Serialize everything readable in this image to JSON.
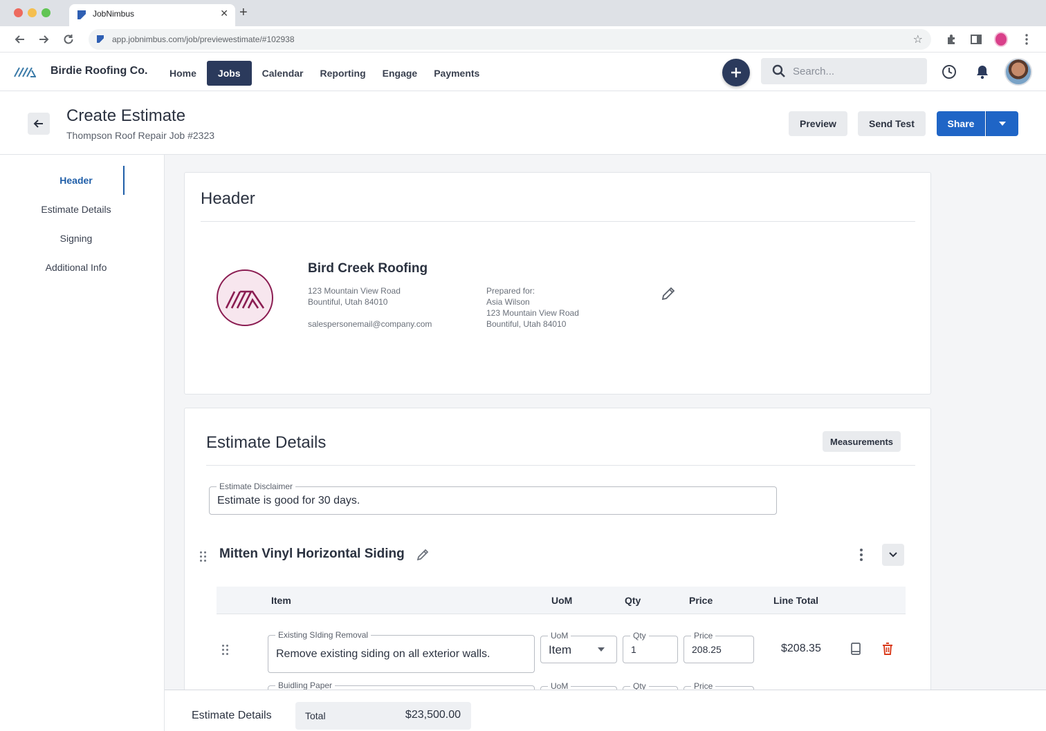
{
  "browser": {
    "tab_title": "JobNimbus",
    "url": "app.jobnimbus.com/job/previewestimate/#102938"
  },
  "app": {
    "brand": "Birdie Roofing Co.",
    "nav": [
      "Home",
      "Jobs",
      "Calendar",
      "Reporting",
      "Engage",
      "Payments"
    ],
    "active_nav": "Jobs",
    "search_placeholder": "Search..."
  },
  "page": {
    "title": "Create Estimate",
    "subtitle": "Thompson Roof Repair Job #2323",
    "preview_label": "Preview",
    "send_test_label": "Send Test",
    "share_label": "Share"
  },
  "sidebar": {
    "items": [
      "Header",
      "Estimate Details",
      "Signing",
      "Additional Info"
    ],
    "active": "Header"
  },
  "header_card": {
    "title": "Header",
    "company_name": "Bird Creek Roofing",
    "company_address_line1": "123 Mountain View Road",
    "company_address_line2": "Bountiful, Utah 84010",
    "company_email": "salespersonemail@company.com",
    "prepared_for_label": "Prepared for:",
    "client_name": "Asia Wilson",
    "client_address_line1": "123 Mountain View Road",
    "client_address_line2": "Bountiful, Utah 84010"
  },
  "estimate_card": {
    "title": "Estimate Details",
    "measurements_label": "Measurements",
    "disclaimer_label": "Estimate Disclaimer",
    "disclaimer_value": "Estimate is good for 30 days.",
    "section_title": "Mitten Vinyl Horizontal Siding",
    "columns": [
      "Item",
      "UoM",
      "Qty",
      "Price",
      "Line Total"
    ],
    "rows": [
      {
        "item_label": "Existing SIding Removal",
        "item_value": "Remove existing siding on all exterior walls.",
        "uom_label": "UoM",
        "uom_value": "Item",
        "qty_label": "Qty",
        "qty_value": "1",
        "price_label": "Price",
        "price_value": "208.25",
        "line_total": "$208.35"
      },
      {
        "item_label": "Buidling Paper",
        "uom_label": "UoM",
        "qty_label": "Qty",
        "price_label": "Price"
      }
    ]
  },
  "footer": {
    "section_label": "Estimate Details",
    "total_label": "Total",
    "total_value": "$23,500.00"
  },
  "colors": {
    "primary_navy": "#2b3a5c",
    "accent_blue": "#1f65c6",
    "brand_magenta": "#8b1d52",
    "danger": "#d93a1b"
  }
}
